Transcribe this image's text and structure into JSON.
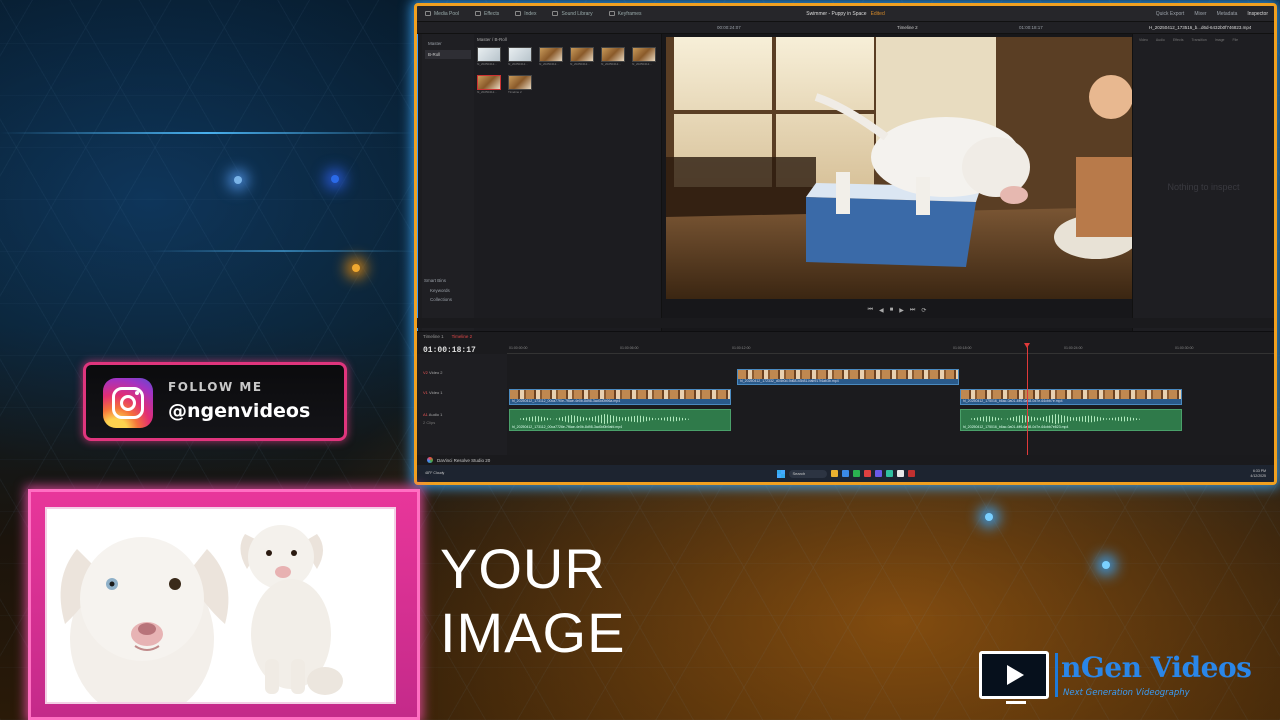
{
  "overlay": {
    "follow_label": "FOLLOW ME",
    "handle": "@ngenvideos",
    "image_placeholder_line1": "YOUR",
    "image_placeholder_line2": "IMAGE",
    "brand_name": "nGen Videos",
    "brand_tagline": "Next Generation Videography"
  },
  "resolve": {
    "top_tabs": [
      "Media Pool",
      "Effects",
      "Index",
      "Sound Library",
      "Keyframes"
    ],
    "project_title": "Swimmer - Puppy in Space",
    "edited_label": "Edited",
    "top_right_tabs": [
      "Quick Export",
      "Mixer",
      "Metadata",
      "Inspector"
    ],
    "viewer_timecode": "00:00:24:07",
    "timeline_name": "Timeline 2",
    "viewer_tc_right": "01:00:18:17",
    "inspector_clip_name": "H_20250412_173516_b...d6d-6432b0f746823.mp4",
    "media_side_items": [
      "Master",
      "B-Roll"
    ],
    "media_path": "Master / B-Roll",
    "smart_bins_title": "Smart Bins",
    "smart_bins": [
      "Keywords",
      "Collections"
    ],
    "inspector_tabs": [
      "Video",
      "Audio",
      "Effects",
      "Transition",
      "Image",
      "File"
    ],
    "inspector_empty": "Nothing to inspect",
    "timeline_tab_1": "Timeline 1",
    "timeline_tab_2": "Timeline 2",
    "timeline_timecode": "01:00:18:17",
    "ruler_ticks": [
      "01:00:00:00",
      "01:00:06:00",
      "01:00:12:00",
      "01:00:18:00",
      "01:00:24:00",
      "01:00:30:00"
    ],
    "tracks": [
      "Video 2",
      "Video 1",
      "Audio 1"
    ],
    "track_ids": [
      "V2",
      "V1",
      "A1"
    ],
    "audio_sub": "2 Clips",
    "clip_v1a": "hl_20250412_173112_00ca77f0e-7f6ae-4e0b-8d98-3ad0d0b96a.mp4",
    "clip_v2": "hl_20250412_172332_d04b0d-9d68-b3b81-bab917f4ab3b.mp4",
    "clip_v1b": "hl_20250412_175016_b6ac-0a01-4ff6-6ad8-0d7e-64cbb7e.mp4",
    "clip_a1a": "hl_20250412_173112_00ca7726e-7f6ae-4e0b-8d98-3ad0d0b9afd.mp4",
    "clip_a1b": "hl_20250412_175016_b6ac-0a01-4ff6-6ad8-0d7e-64cbb7e823.mp4",
    "app_name": "DaVinci Resolve Studio 20",
    "thumbs": [
      "hl_20250412...",
      "hl_20250412...",
      "hl_20250412...",
      "hl_20250412...",
      "hl_20250412...",
      "hl_20250412...",
      "hl_20250412...",
      "Timeline 2"
    ],
    "taskbar_search": "Search",
    "weather": "48°F Cloudy",
    "clock_time": "6:33 PM",
    "clock_date": "4/12/2025"
  }
}
